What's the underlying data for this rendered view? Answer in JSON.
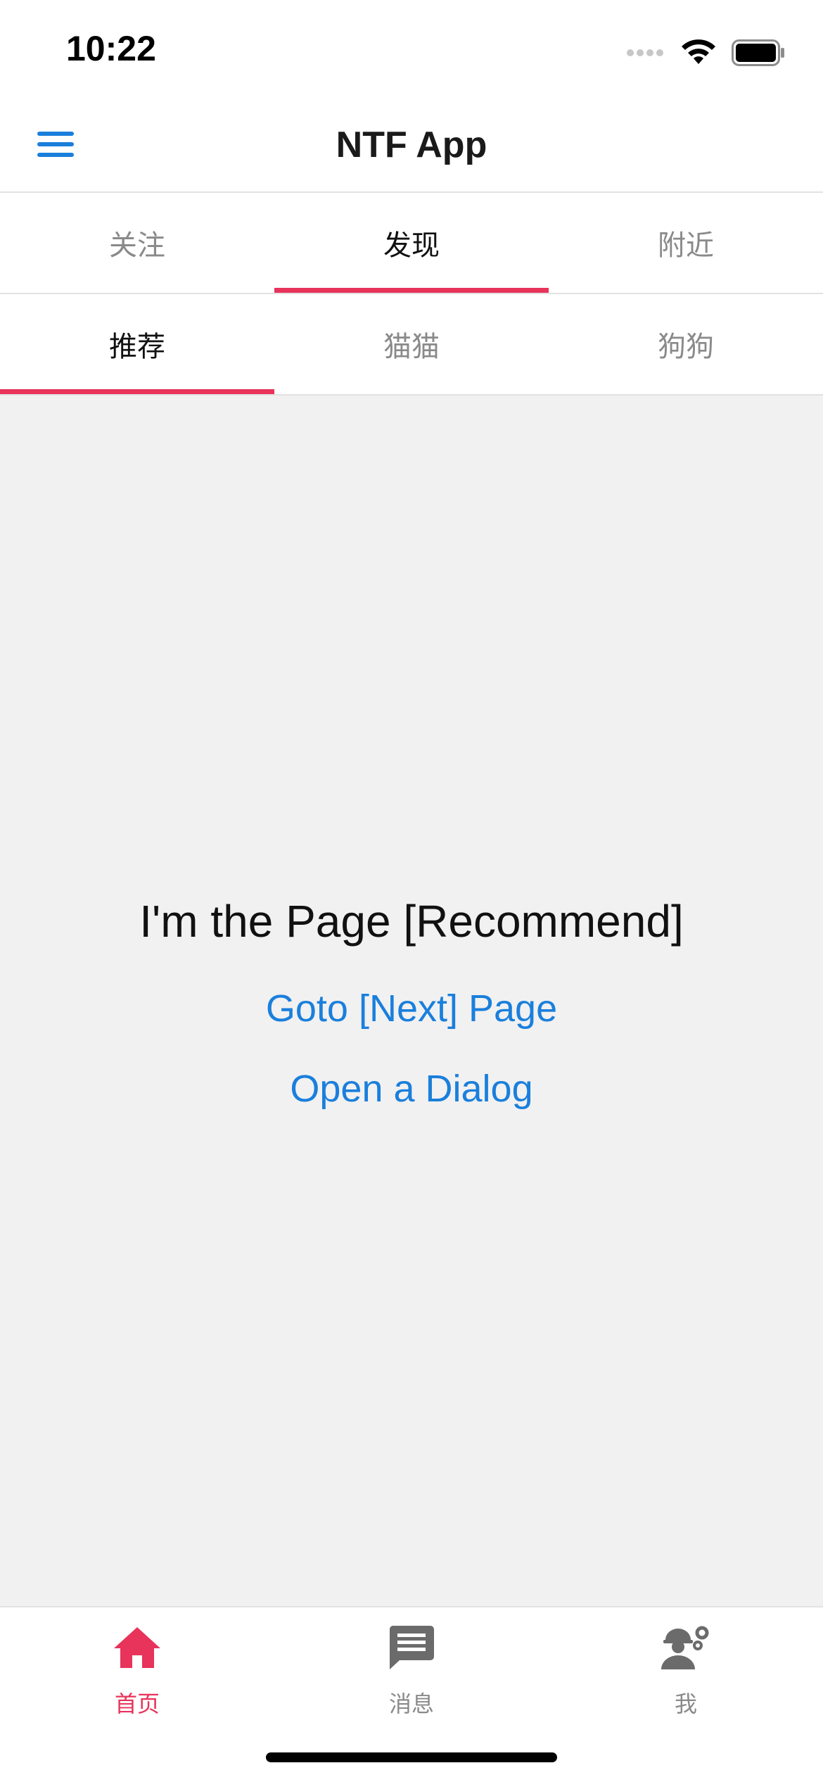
{
  "status_bar": {
    "time": "10:22"
  },
  "header": {
    "title": "NTF App"
  },
  "tabs_primary": [
    {
      "label": "关注",
      "active": false
    },
    {
      "label": "发现",
      "active": true
    },
    {
      "label": "附近",
      "active": false
    }
  ],
  "tabs_secondary": [
    {
      "label": "推荐",
      "active": true
    },
    {
      "label": "猫猫",
      "active": false
    },
    {
      "label": "狗狗",
      "active": false
    }
  ],
  "content": {
    "page_text": "I'm the Page [Recommend]",
    "goto_next_link": "Goto [Next] Page",
    "open_dialog_link": "Open a Dialog"
  },
  "bottom_tabs": [
    {
      "label": "首页",
      "icon": "home-icon",
      "active": true
    },
    {
      "label": "消息",
      "icon": "message-icon",
      "active": false
    },
    {
      "label": "我",
      "icon": "profile-settings-icon",
      "active": false
    }
  ],
  "colors": {
    "accent": "#e8335a",
    "link": "#1a7fdc",
    "content_bg": "#f1f1f1",
    "inactive_text": "#8a8a8a"
  }
}
